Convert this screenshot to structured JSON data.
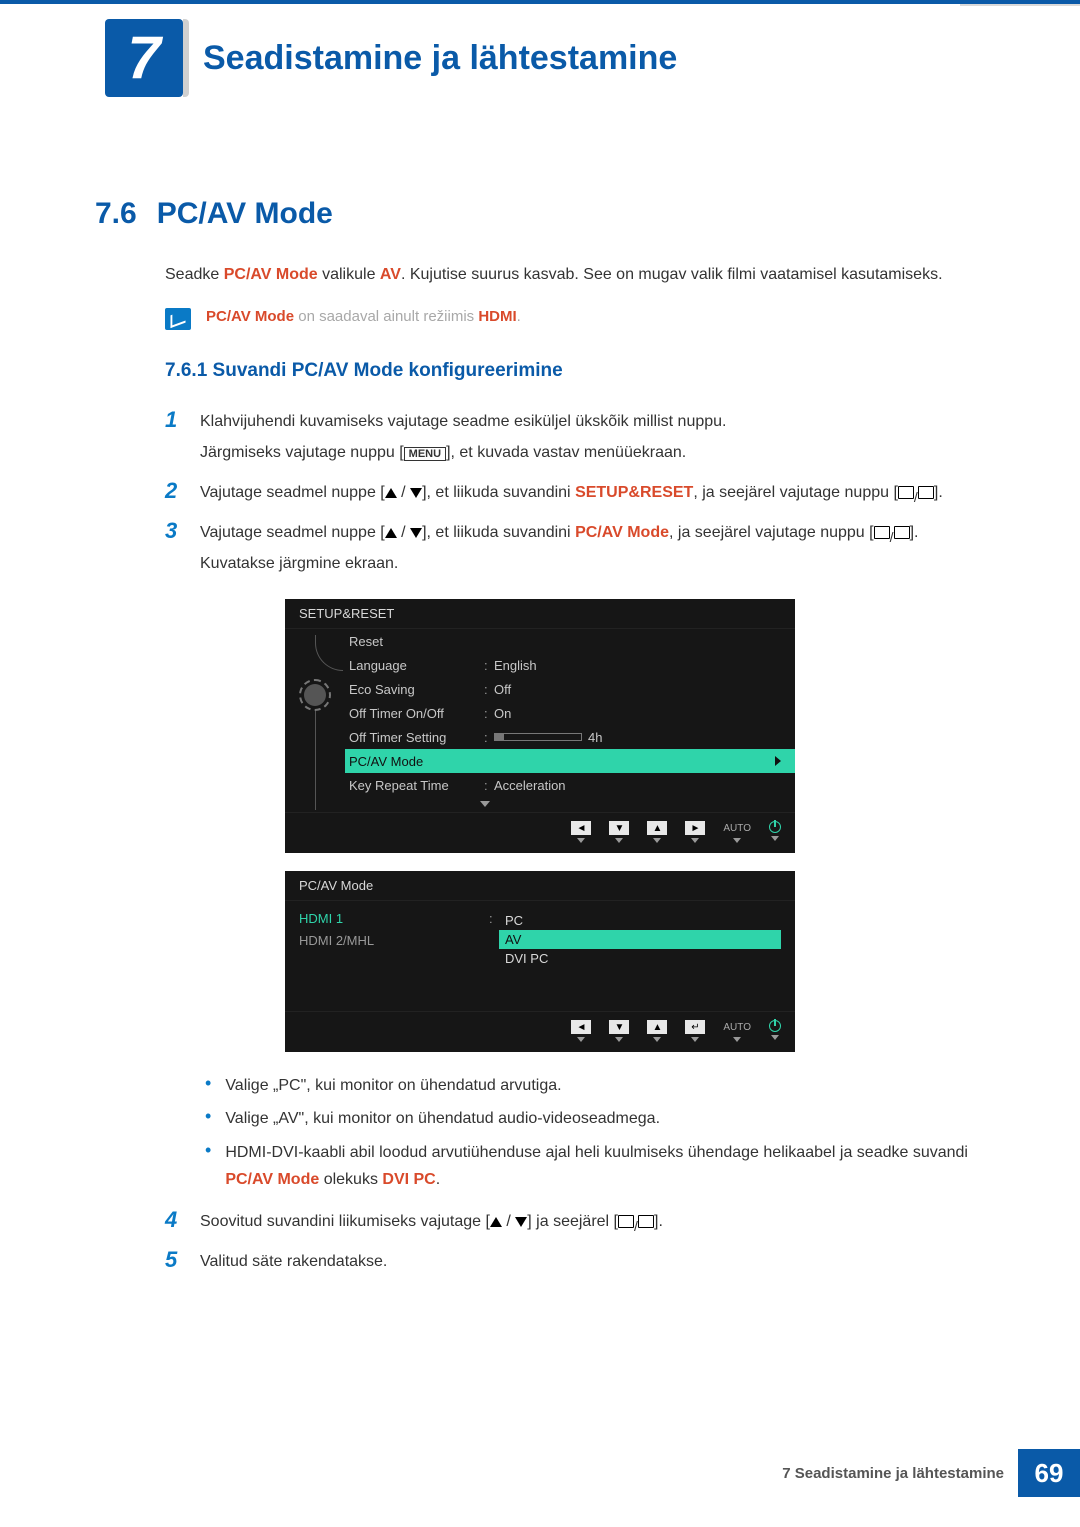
{
  "chapter": {
    "number": "7",
    "title": "Seadistamine ja lähtestamine"
  },
  "section": {
    "number": "7.6",
    "title": "PC/AV Mode"
  },
  "intro": {
    "pre": "Seadke ",
    "hl1": "PC/AV Mode",
    "mid1": " valikule ",
    "hl2": "AV",
    "post": ". Kujutise suurus kasvab. See on mugav valik filmi vaatamisel kasutamiseks."
  },
  "note": {
    "hl1": "PC/AV Mode",
    "mid": " on saadaval ainult režiimis ",
    "hl2": "HDMI",
    "end": "."
  },
  "subsection": "7.6.1  Suvandi PC/AV Mode konfigureerimine",
  "steps": {
    "s1a": "Klahvijuhendi kuvamiseks vajutage seadme esiküljel ükskõik millist nuppu.",
    "s1b_pre": "Järgmiseks vajutage nuppu [",
    "s1b_menu": "MENU",
    "s1b_post": "], et kuvada vastav menüüekraan.",
    "s2_pre": "Vajutage seadmel nuppe [",
    "s2_mid": "], et liikuda suvandini ",
    "s2_hl": "SETUP&RESET",
    "s2_post": ", ja seejärel vajutage nuppu [",
    "s3_pre": "Vajutage seadmel nuppe [",
    "s3_mid": "], et liikuda suvandini ",
    "s3_hl": "PC/AV Mode",
    "s3_post": ", ja seejärel vajutage nuppu [",
    "s3b": "Kuvatakse järgmine ekraan.",
    "s4_pre": "Soovitud suvandini liikumiseks vajutage [",
    "s4_mid": "] ja seejärel [",
    "s5": "Valitud säte rakendatakse.",
    "brkend": "]."
  },
  "osd1": {
    "title": "SETUP&RESET",
    "rows": [
      {
        "lbl": "Reset",
        "val": ""
      },
      {
        "lbl": "Language",
        "val": "English"
      },
      {
        "lbl": "Eco Saving",
        "val": "Off"
      },
      {
        "lbl": "Off Timer On/Off",
        "val": "On"
      },
      {
        "lbl": "Off Timer Setting",
        "val": "4h",
        "slider": true
      },
      {
        "lbl": "PC/AV Mode",
        "val": "",
        "selected": true
      },
      {
        "lbl": "Key Repeat Time",
        "val": "Acceleration"
      }
    ],
    "nav_auto": "AUTO",
    "nav_left": "◄",
    "nav_down": "▼",
    "nav_up": "▲",
    "nav_right": "►"
  },
  "osd2": {
    "title": "PC/AV Mode",
    "row1": {
      "lbl": "HDMI 1",
      "opts": [
        "PC",
        "AV",
        "DVI PC"
      ],
      "selected": "AV"
    },
    "row2_lbl": "HDMI 2/MHL",
    "nav_left": "◄",
    "nav_down": "▼",
    "nav_up": "▲",
    "nav_enter": "↵",
    "nav_auto": "AUTO"
  },
  "bullets": {
    "b1": "Valige „PC\", kui monitor on ühendatud arvutiga.",
    "b2": "Valige „AV\", kui monitor on ühendatud audio-videoseadmega.",
    "b3_pre": "HDMI-DVI-kaabli abil loodud arvutiühenduse ajal heli kuulmiseks ühendage helikaabel ja seadke suvandi ",
    "b3_hl1": "PC/AV Mode",
    "b3_mid": " olekuks ",
    "b3_hl2": "DVI PC",
    "b3_end": "."
  },
  "footer": {
    "text": "7 Seadistamine ja lähtestamine",
    "page": "69"
  }
}
